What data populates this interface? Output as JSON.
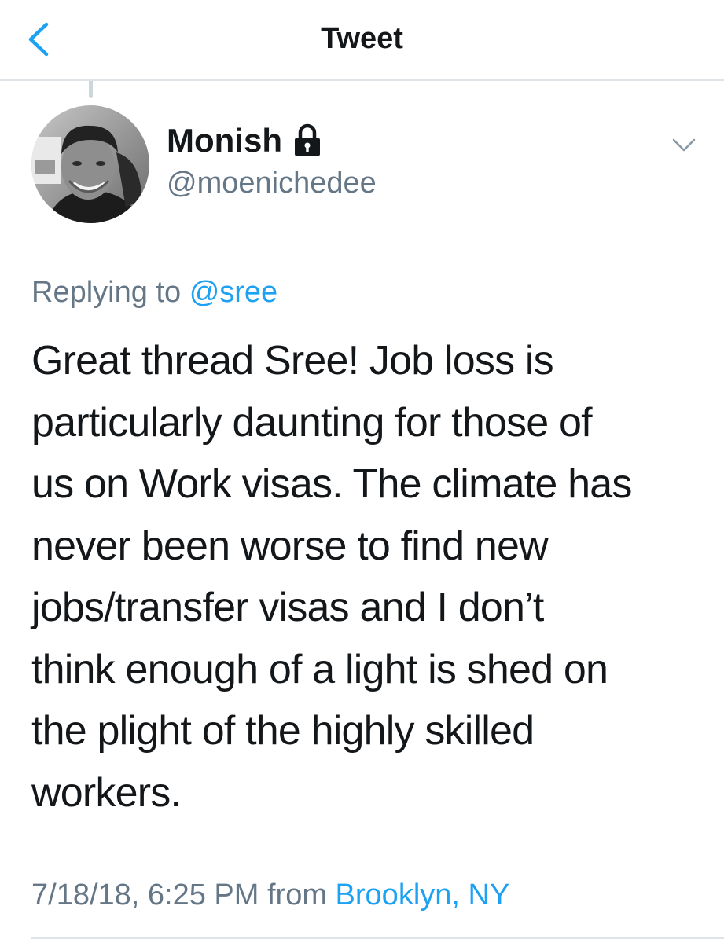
{
  "nav": {
    "title": "Tweet"
  },
  "author": {
    "display_name": "Monish",
    "handle": "@moenichedee",
    "protected_icon": "lock-icon"
  },
  "reply": {
    "prefix": "Replying to",
    "to_handle": "@sree"
  },
  "tweet": {
    "lines": [
      "Great thread Sree! Job loss is",
      "particularly daunting for those of",
      "us on Work visas. The climate has",
      "never been worse to find new",
      "jobs/transfer visas and I don’t",
      "think enough of a light is shed on",
      "the plight of the highly skilled",
      "workers."
    ]
  },
  "meta": {
    "timestamp": "7/18/18, 6:25 PM",
    "from_label": "from",
    "location": "Brooklyn, NY"
  },
  "icons": {
    "back": "chevron-left-icon",
    "menu": "chevron-down-icon",
    "lock": "lock-icon"
  },
  "colors": {
    "accent": "#1da1f2",
    "text_primary": "#14171a",
    "text_secondary": "#657786",
    "divider": "#dde3e7"
  }
}
